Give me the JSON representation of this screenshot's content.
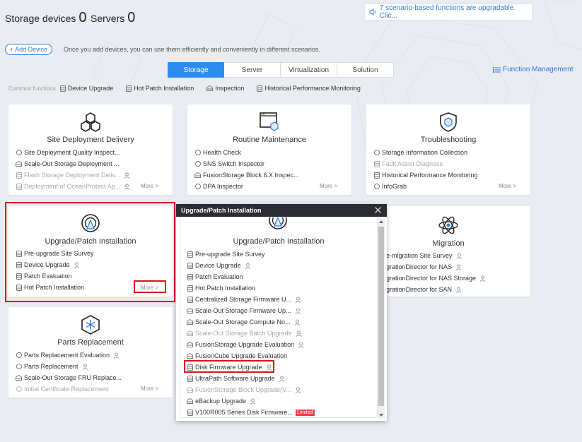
{
  "header": {
    "storage_label": "Storage devices",
    "storage_count": "0",
    "servers_label": "Servers",
    "servers_count": "0",
    "notice": "7 scenario-based functions are upgradable. Clic..."
  },
  "toolbar": {
    "add_device": "+ Add Device",
    "hint": "Once you add devices, you can use them efficiently and conveniently in different scenarios.",
    "function_management": "Function Management"
  },
  "tabs": [
    "Storage",
    "Server",
    "Virtualization",
    "Solution"
  ],
  "common_functions": {
    "label": "Common functions",
    "items": [
      "Device Upgrade",
      "Hot Patch Installation",
      "Inspection",
      "Historical Performance Monitoring"
    ]
  },
  "cards": {
    "site": {
      "title": "Site Deployment Delivery",
      "items": [
        "Site Deployment Quality Inspect...",
        "Scale-Out Storage Deployment ...",
        "Flash Storage Deployment Deliv...",
        "Deployment of OceanProtect Ap..."
      ],
      "more": "More  >"
    },
    "routine": {
      "title": "Routine Maintenance",
      "items": [
        "Health Check",
        "SNS Switch Inspector",
        "FusionStorage Block 6.X Inspec...",
        "DPA Inspector"
      ],
      "more": "More  >"
    },
    "trouble": {
      "title": "Troubleshooting",
      "items": [
        "Storage Information Collection",
        "Fault Assist Diagnose",
        "Historical Performance Monitoring",
        "InfoGrab"
      ],
      "more": "More  >"
    },
    "upgrade": {
      "title": "Upgrade/Patch Installation",
      "items": [
        "Pre-upgrade Site Survey",
        "Device Upgrade",
        "Patch Evaluation",
        "Hot Patch Installation"
      ],
      "more": "More  >"
    },
    "migration": {
      "title": "Migration",
      "items": [
        "e-migration Site Survey",
        "grationDirector for NAS",
        "grationDirector for NAS Storage",
        "grationDirector for SAN"
      ]
    },
    "parts": {
      "title": "Parts Replacement",
      "items": [
        "Parts Replacement Evaluation",
        "Parts Replacement",
        "Scale-Out Storage FRU Replace...",
        "Initial Certificate Replacement"
      ],
      "more": "More  >"
    }
  },
  "dialog": {
    "title": "Upgrade/Patch Installation",
    "heading": "Upgrade/Patch Installation",
    "items": [
      "Pre-upgrade Site Survey",
      "Device Upgrade",
      "Patch Evaluation",
      "Hot Patch Installation",
      "Centralized Storage Firmware U...",
      "Scale-Out Storage Firmware Up...",
      "Scale-Out Storage Compute No...",
      "Scale-Out Storage Batch Upgrade",
      "FusionStorage Upgrade Evaluation",
      "FusionCube Upgrade Evaluation",
      "Disk Firmware Upgrade",
      "UltraPath Software Upgrade",
      "FusionStorage Block Upgrade(V...",
      "eBackup Upgrade",
      "V100R005 Series Disk Firmware..."
    ],
    "limited": "Limited"
  },
  "colors": {
    "accent": "#2d8cf0",
    "highlight": "#d9121a",
    "dialog_header": "#2b2d33"
  }
}
